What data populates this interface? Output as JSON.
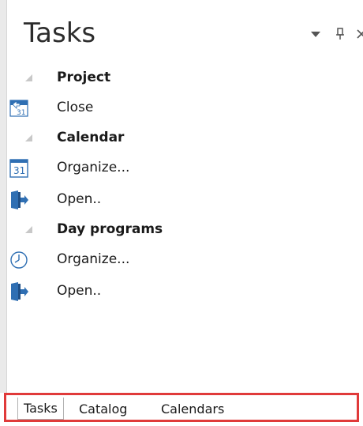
{
  "pane": {
    "title": "Tasks",
    "controls": {
      "dropdown_icon": "dropdown-triangle-icon",
      "pin_icon": "pin-icon",
      "close_icon": "close-icon"
    }
  },
  "groups": [
    {
      "label": "Project",
      "items": [
        {
          "label": "Close",
          "icon": "calendar-close-icon"
        }
      ]
    },
    {
      "label": "Calendar",
      "items": [
        {
          "label": "Organize...",
          "icon": "calendar-31-icon"
        },
        {
          "label": "Open..",
          "icon": "open-door-icon"
        }
      ]
    },
    {
      "label": "Day programs",
      "items": [
        {
          "label": "Organize...",
          "icon": "clock-icon"
        },
        {
          "label": "Open..",
          "icon": "open-door-icon"
        }
      ]
    }
  ],
  "tabs": [
    {
      "label": "Tasks",
      "active": true
    },
    {
      "label": "Catalog",
      "active": false
    },
    {
      "label": "Calendars",
      "active": false
    }
  ],
  "colors": {
    "highlight_border": "#e03a3a",
    "icon_blue": "#2f6fb3",
    "text": "#1a1a1a"
  }
}
